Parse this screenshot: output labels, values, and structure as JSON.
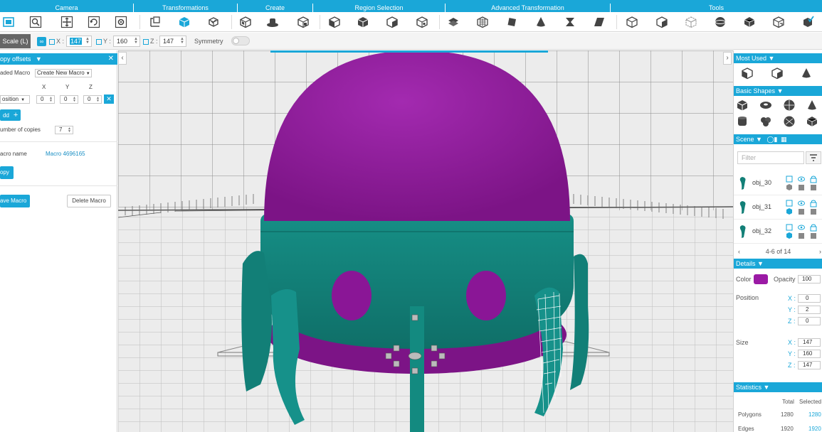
{
  "toolbar": {
    "categories": [
      "Camera",
      "Transformations",
      "Create",
      "Region Selection",
      "Advanced Transformation",
      "Tools"
    ]
  },
  "options_bar": {
    "mode_tab": "Scale (L)",
    "x_label": "X :",
    "x_value": "147",
    "y_label": "Y :",
    "y_value": "160",
    "z_label": "Z :",
    "z_value": "147",
    "symmetry_label": "Symmetry"
  },
  "left_panel": {
    "title": "opy offsets",
    "loaded_macro_label": "aded Macro",
    "loaded_macro_value": "Create New Macro",
    "axis_x": "X",
    "axis_y": "Y",
    "axis_z": "Z",
    "offset_type": "osition",
    "offset_x": "0",
    "offset_y": "0",
    "offset_z": "0",
    "add_label": "dd",
    "copies_label": "umber of copies",
    "copies_value": "7",
    "macro_name_label": "acro name",
    "macro_name_value": "Macro 4696165",
    "copy_button": "opy",
    "save_button": "ave Macro",
    "delete_button": "Delete Macro"
  },
  "right_panel": {
    "most_used_title": "Most Used",
    "basic_shapes_title": "Basic Shapes",
    "scene_title": "Scene",
    "filter_placeholder": "Filter",
    "objects": [
      {
        "name": "obj_30"
      },
      {
        "name": "obj_31"
      },
      {
        "name": "obj_32"
      }
    ],
    "pager": "4-6 of 14",
    "details_title": "Details",
    "color_label": "Color",
    "color_value": "#9b1aa5",
    "opacity_label": "Opacity",
    "opacity_value": "100",
    "position_label": "Position",
    "position": {
      "x": "0",
      "y": "2",
      "z": "0"
    },
    "size_label": "Size",
    "size": {
      "x": "147",
      "y": "160",
      "z": "147"
    },
    "axis_x": "X :",
    "axis_y": "Y :",
    "axis_z": "Z :",
    "statistics_title": "Statistics",
    "stats_total_header": "Total",
    "stats_selected_header": "Selected",
    "stats": [
      {
        "label": "Polygons",
        "total": "1280",
        "selected": "1280"
      },
      {
        "label": "Edges",
        "total": "1920",
        "selected": "1920"
      }
    ]
  },
  "colors": {
    "accent": "#1aa7d8",
    "object_magenta": "#9b1aa5",
    "object_teal": "#138a80"
  }
}
